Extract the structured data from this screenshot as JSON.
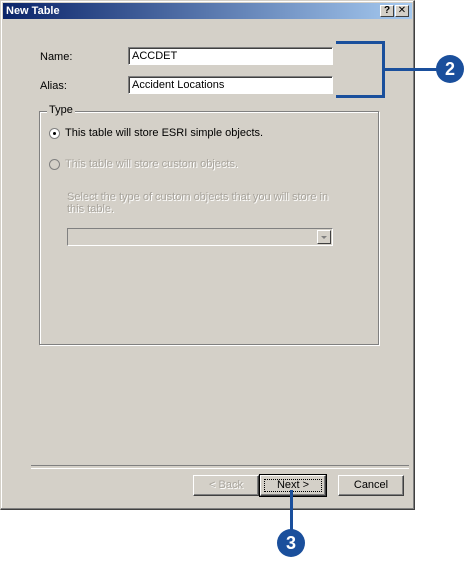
{
  "window": {
    "title": "New Table",
    "help_button": "?",
    "close_button": "✕"
  },
  "fields": {
    "name_label": "Name:",
    "name_value": "ACCDET",
    "alias_label": "Alias:",
    "alias_value": "Accident Locations"
  },
  "type_group": {
    "legend": "Type",
    "option_simple": "This table will store ESRI simple objects.",
    "option_simple_selected": true,
    "option_custom": "This table will store custom objects.",
    "option_custom_selected": false,
    "custom_hint": "Select the type of custom objects that you will store in this table.",
    "custom_select_value": ""
  },
  "buttons": {
    "back": "< Back",
    "next": "Next >",
    "cancel": "Cancel"
  },
  "callouts": {
    "step_fields": "2",
    "step_next": "3",
    "color": "#1a4f9c"
  }
}
